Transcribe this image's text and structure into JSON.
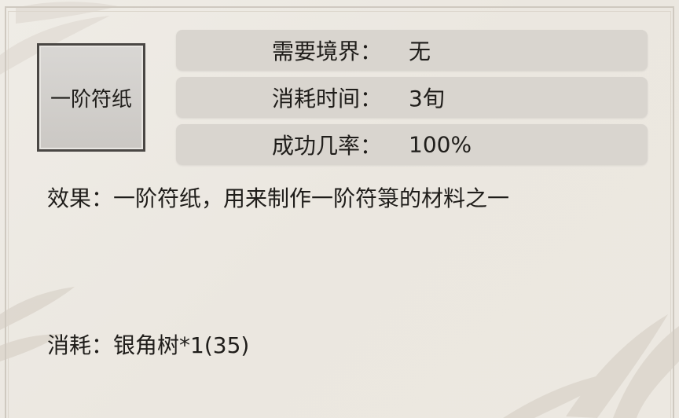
{
  "item": {
    "name": "一阶符纸"
  },
  "stats": [
    {
      "label": "需要境界：",
      "value": "无"
    },
    {
      "label": "消耗时间：",
      "value": "3旬"
    },
    {
      "label": "成功几率：",
      "value": "100%"
    }
  ],
  "effect": {
    "label": "效果：",
    "text": "一阶符纸，用来制作一阶符箓的材料之一"
  },
  "cost": {
    "label": "消耗：",
    "text": "银角树*1(35)"
  },
  "colors": {
    "background": "#ece8e1",
    "row_background": "#d9d5cf",
    "item_border": "#4a4744",
    "text": "#1f1d1a"
  }
}
